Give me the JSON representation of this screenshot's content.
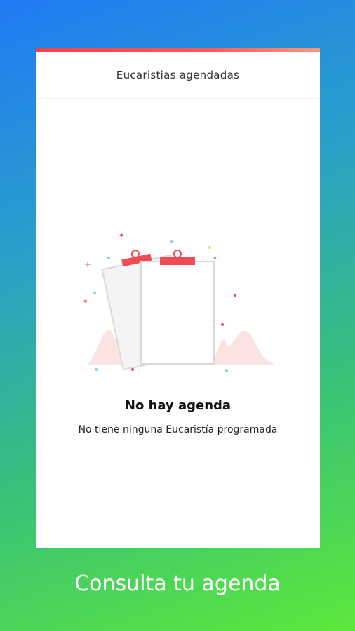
{
  "screen": {
    "title": "Eucaristias agendadas",
    "empty_state": {
      "illustration": "empty-clipboard-icon",
      "title": "No hay agenda",
      "subtitle": "No tiene ninguna Eucaristía programada"
    }
  },
  "caption": "Consulta tu agenda",
  "colors": {
    "accent": "#F0424E",
    "gradient_top": "#1F7BF5",
    "gradient_bottom": "#5CE83A"
  }
}
